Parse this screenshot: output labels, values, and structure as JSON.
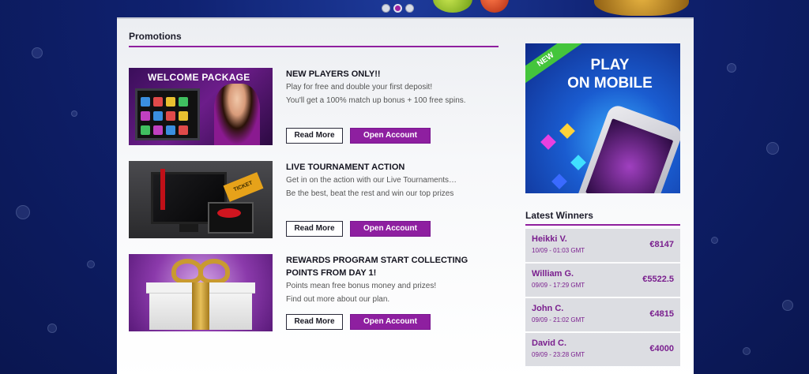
{
  "carousel": {
    "dots": 3,
    "active_index": 1
  },
  "promotions": {
    "heading": "Promotions",
    "items": [
      {
        "image_label": "WELCOME PACKAGE",
        "title": "NEW PLAYERS ONLY!!",
        "desc_lines": [
          "Play for free and double your first deposit!",
          "You'll get a 100% match up bonus + 100 free spins."
        ],
        "read_more": "Read More",
        "open_account": "Open Account"
      },
      {
        "image_label": "TICKET",
        "title": "LIVE TOURNAMENT ACTION",
        "desc_lines": [
          "Get in on the action with our Live Tournaments…",
          "Be the best, beat the rest and win our top prizes"
        ],
        "read_more": "Read More",
        "open_account": "Open Account"
      },
      {
        "title_lines": [
          "REWARDS PROGRAM START COLLECTING",
          "POINTS FROM DAY 1!"
        ],
        "desc_lines": [
          "Points mean free bonus money and prizes!",
          "Find out more about our plan."
        ],
        "read_more": "Read More",
        "open_account": "Open Account"
      }
    ]
  },
  "mobile_banner": {
    "badge": "NEW",
    "title_line1": "PLAY",
    "title_line2": "ON MOBILE"
  },
  "winners": {
    "heading": "Latest Winners",
    "items": [
      {
        "name": "Heikki V.",
        "time": "10/09 - 01:03 GMT",
        "amount": "€8147"
      },
      {
        "name": "William G.",
        "time": "09/09 - 17:29 GMT",
        "amount": "€5522.5"
      },
      {
        "name": "John C.",
        "time": "09/09 - 21:02 GMT",
        "amount": "€4815"
      },
      {
        "name": "David C.",
        "time": "09/09 - 23:28 GMT",
        "amount": "€4000"
      }
    ]
  },
  "colors": {
    "accent": "#8e1fa0",
    "winner_text": "#7a1f8e",
    "background": "#0f2170"
  }
}
